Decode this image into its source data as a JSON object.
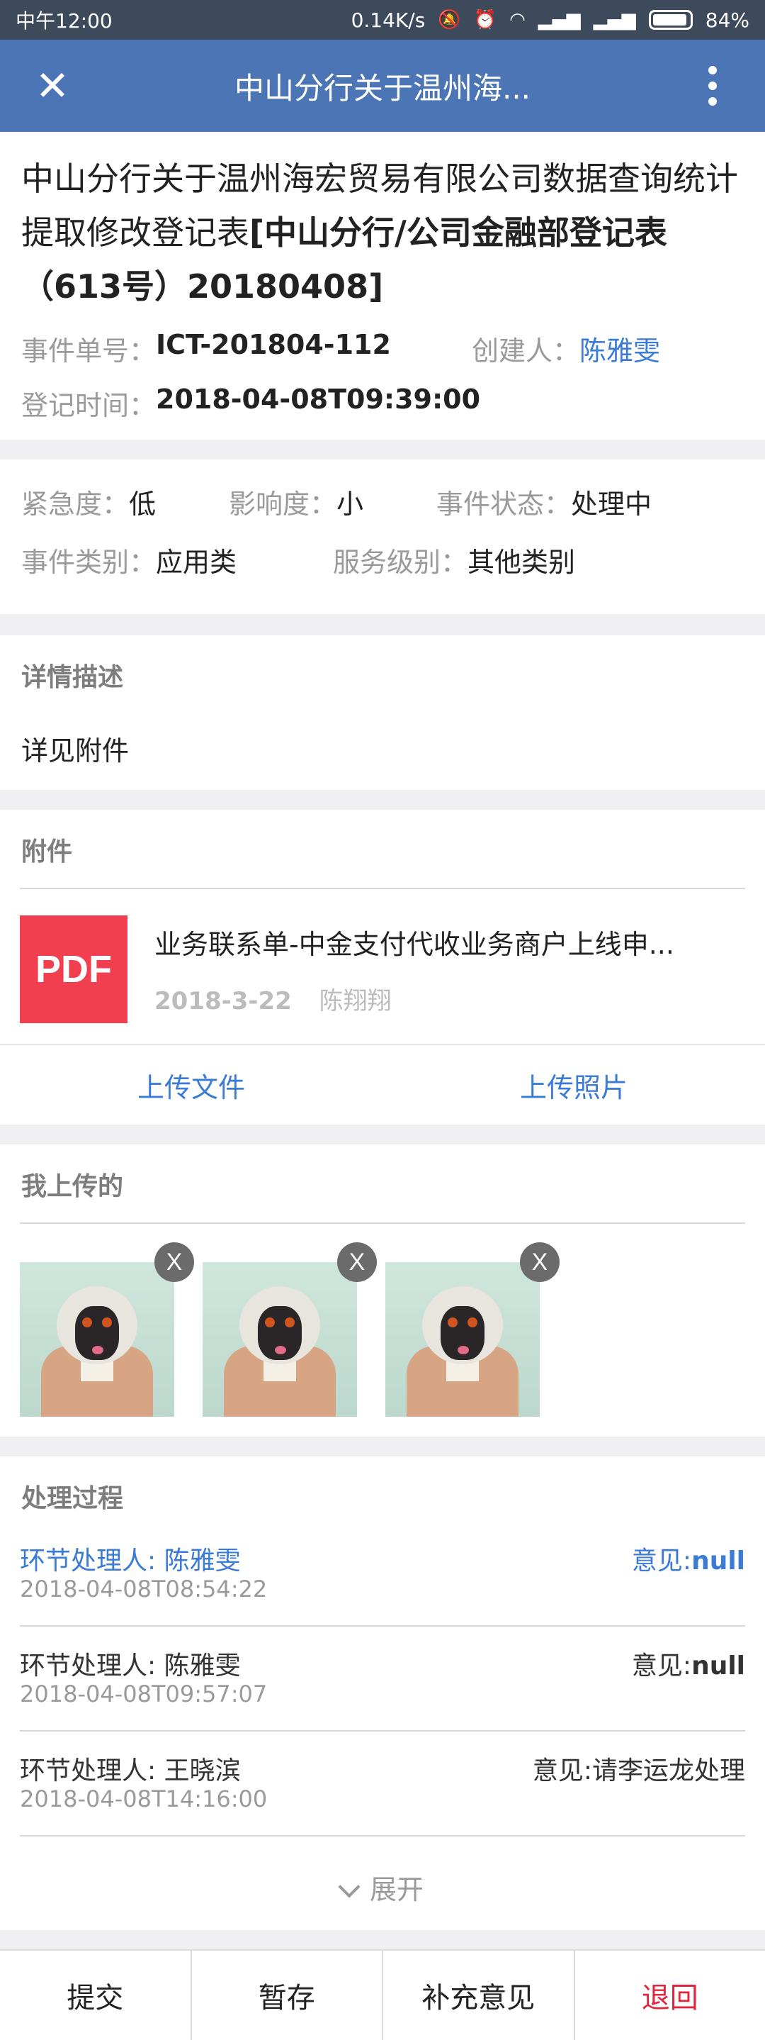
{
  "status_bar": {
    "time": "中午12:00",
    "speed": "0.14K/s",
    "battery": "84%",
    "icons": [
      "mute-icon",
      "alarm-icon",
      "wifi-icon",
      "signal-icon",
      "signal-icon",
      "battery-icon"
    ]
  },
  "titlebar": {
    "title": "中山分行关于温州海..."
  },
  "header": {
    "title_line_a": "中山分行关于温州海宏贸易有限公司数据查询统计提取修改登记表",
    "title_line_b": "[中山分行/公司金融部登记表（613号）20180408]",
    "ticket_label": "事件单号：",
    "ticket_value": "ICT-201804-112",
    "creator_label": "创建人：",
    "creator_value": "陈雅雯",
    "time_label": "登记时间：",
    "time_value": "2018-04-08T09:39:00"
  },
  "props": {
    "urgency_label": "紧急度：",
    "urgency_value": "低",
    "impact_label": "影响度：",
    "impact_value": "小",
    "status_label": "事件状态：",
    "status_value": "处理中",
    "category_label": "事件类别：",
    "category_value": "应用类",
    "service_label": "服务级别：",
    "service_value": "其他类别"
  },
  "detail": {
    "heading": "详情描述",
    "text": "详见附件"
  },
  "attachments": {
    "heading": "附件",
    "file_badge": "PDF",
    "file_name": "业务联系单-中金支付代收业务商户上线申...",
    "file_date": "2018-3-22",
    "file_author": "陈翔翔",
    "upload_file": "上传文件",
    "upload_photo": "上传照片"
  },
  "my_uploads": {
    "heading": "我上传的",
    "remove_label": "X",
    "count": 3
  },
  "process": {
    "heading": "处理过程",
    "items": [
      {
        "handler": "环节处理人: 陈雅雯",
        "opinion_prefix": "意见:",
        "opinion": "null",
        "time": "2018-04-08T08:54:22",
        "active": true
      },
      {
        "handler": "环节处理人: 陈雅雯",
        "opinion_prefix": "意见:",
        "opinion": "null",
        "time": "2018-04-08T09:57:07",
        "active": false
      },
      {
        "handler": "环节处理人: 王晓滨",
        "opinion_prefix": "意见:",
        "opinion": "请李运龙处理",
        "time": "2018-04-08T14:16:00",
        "active": false
      }
    ],
    "expand_label": "展开"
  },
  "bottom_bar": {
    "submit": "提交",
    "save_draft": "暂存",
    "add_opinion": "补充意见",
    "return": "退回"
  },
  "colors": {
    "title_bar": "#4b75b4",
    "link_blue": "#3a7bd5",
    "pdf_red": "#f23f50",
    "return_red": "#e0253c"
  }
}
